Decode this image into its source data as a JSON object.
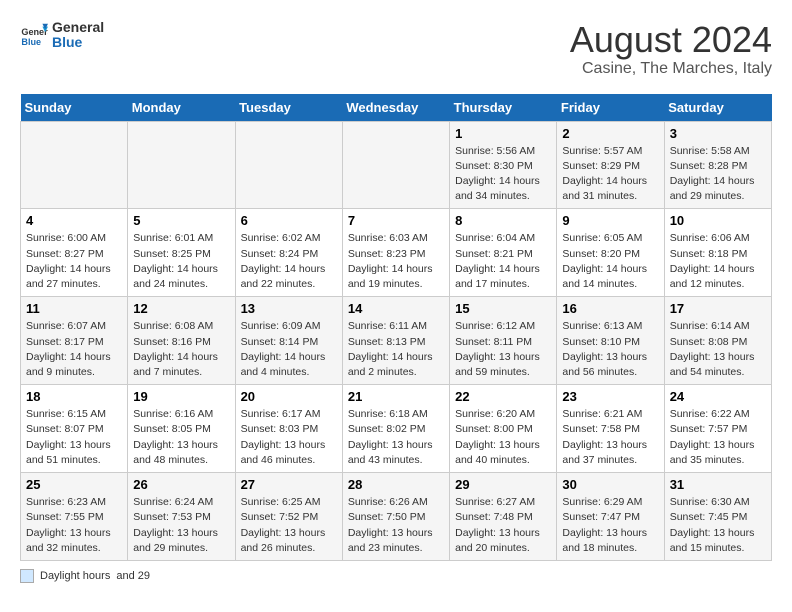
{
  "header": {
    "logo_line1": "General",
    "logo_line2": "Blue",
    "title": "August 2024",
    "subtitle": "Casine, The Marches, Italy"
  },
  "weekdays": [
    "Sunday",
    "Monday",
    "Tuesday",
    "Wednesday",
    "Thursday",
    "Friday",
    "Saturday"
  ],
  "weeks": [
    [
      {
        "day": "",
        "info": ""
      },
      {
        "day": "",
        "info": ""
      },
      {
        "day": "",
        "info": ""
      },
      {
        "day": "",
        "info": ""
      },
      {
        "day": "1",
        "info": "Sunrise: 5:56 AM\nSunset: 8:30 PM\nDaylight: 14 hours and 34 minutes."
      },
      {
        "day": "2",
        "info": "Sunrise: 5:57 AM\nSunset: 8:29 PM\nDaylight: 14 hours and 31 minutes."
      },
      {
        "day": "3",
        "info": "Sunrise: 5:58 AM\nSunset: 8:28 PM\nDaylight: 14 hours and 29 minutes."
      }
    ],
    [
      {
        "day": "4",
        "info": "Sunrise: 6:00 AM\nSunset: 8:27 PM\nDaylight: 14 hours and 27 minutes."
      },
      {
        "day": "5",
        "info": "Sunrise: 6:01 AM\nSunset: 8:25 PM\nDaylight: 14 hours and 24 minutes."
      },
      {
        "day": "6",
        "info": "Sunrise: 6:02 AM\nSunset: 8:24 PM\nDaylight: 14 hours and 22 minutes."
      },
      {
        "day": "7",
        "info": "Sunrise: 6:03 AM\nSunset: 8:23 PM\nDaylight: 14 hours and 19 minutes."
      },
      {
        "day": "8",
        "info": "Sunrise: 6:04 AM\nSunset: 8:21 PM\nDaylight: 14 hours and 17 minutes."
      },
      {
        "day": "9",
        "info": "Sunrise: 6:05 AM\nSunset: 8:20 PM\nDaylight: 14 hours and 14 minutes."
      },
      {
        "day": "10",
        "info": "Sunrise: 6:06 AM\nSunset: 8:18 PM\nDaylight: 14 hours and 12 minutes."
      }
    ],
    [
      {
        "day": "11",
        "info": "Sunrise: 6:07 AM\nSunset: 8:17 PM\nDaylight: 14 hours and 9 minutes."
      },
      {
        "day": "12",
        "info": "Sunrise: 6:08 AM\nSunset: 8:16 PM\nDaylight: 14 hours and 7 minutes."
      },
      {
        "day": "13",
        "info": "Sunrise: 6:09 AM\nSunset: 8:14 PM\nDaylight: 14 hours and 4 minutes."
      },
      {
        "day": "14",
        "info": "Sunrise: 6:11 AM\nSunset: 8:13 PM\nDaylight: 14 hours and 2 minutes."
      },
      {
        "day": "15",
        "info": "Sunrise: 6:12 AM\nSunset: 8:11 PM\nDaylight: 13 hours and 59 minutes."
      },
      {
        "day": "16",
        "info": "Sunrise: 6:13 AM\nSunset: 8:10 PM\nDaylight: 13 hours and 56 minutes."
      },
      {
        "day": "17",
        "info": "Sunrise: 6:14 AM\nSunset: 8:08 PM\nDaylight: 13 hours and 54 minutes."
      }
    ],
    [
      {
        "day": "18",
        "info": "Sunrise: 6:15 AM\nSunset: 8:07 PM\nDaylight: 13 hours and 51 minutes."
      },
      {
        "day": "19",
        "info": "Sunrise: 6:16 AM\nSunset: 8:05 PM\nDaylight: 13 hours and 48 minutes."
      },
      {
        "day": "20",
        "info": "Sunrise: 6:17 AM\nSunset: 8:03 PM\nDaylight: 13 hours and 46 minutes."
      },
      {
        "day": "21",
        "info": "Sunrise: 6:18 AM\nSunset: 8:02 PM\nDaylight: 13 hours and 43 minutes."
      },
      {
        "day": "22",
        "info": "Sunrise: 6:20 AM\nSunset: 8:00 PM\nDaylight: 13 hours and 40 minutes."
      },
      {
        "day": "23",
        "info": "Sunrise: 6:21 AM\nSunset: 7:58 PM\nDaylight: 13 hours and 37 minutes."
      },
      {
        "day": "24",
        "info": "Sunrise: 6:22 AM\nSunset: 7:57 PM\nDaylight: 13 hours and 35 minutes."
      }
    ],
    [
      {
        "day": "25",
        "info": "Sunrise: 6:23 AM\nSunset: 7:55 PM\nDaylight: 13 hours and 32 minutes."
      },
      {
        "day": "26",
        "info": "Sunrise: 6:24 AM\nSunset: 7:53 PM\nDaylight: 13 hours and 29 minutes."
      },
      {
        "day": "27",
        "info": "Sunrise: 6:25 AM\nSunset: 7:52 PM\nDaylight: 13 hours and 26 minutes."
      },
      {
        "day": "28",
        "info": "Sunrise: 6:26 AM\nSunset: 7:50 PM\nDaylight: 13 hours and 23 minutes."
      },
      {
        "day": "29",
        "info": "Sunrise: 6:27 AM\nSunset: 7:48 PM\nDaylight: 13 hours and 20 minutes."
      },
      {
        "day": "30",
        "info": "Sunrise: 6:29 AM\nSunset: 7:47 PM\nDaylight: 13 hours and 18 minutes."
      },
      {
        "day": "31",
        "info": "Sunrise: 6:30 AM\nSunset: 7:45 PM\nDaylight: 13 hours and 15 minutes."
      }
    ]
  ],
  "note": {
    "box_label": "Daylight hours",
    "detail": "and 29"
  }
}
